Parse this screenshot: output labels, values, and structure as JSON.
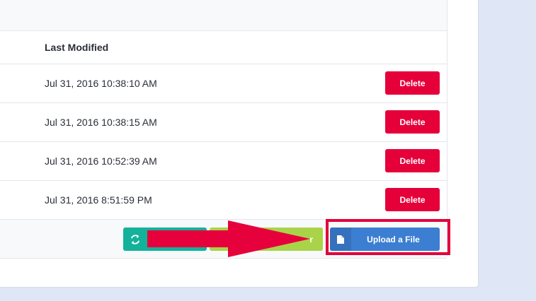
{
  "table": {
    "column_header": "Last Modified",
    "rows": [
      {
        "date": "Jul 31, 2016 10:38:10 AM",
        "action": "Delete"
      },
      {
        "date": "Jul 31, 2016 10:38:15 AM",
        "action": "Delete"
      },
      {
        "date": "Jul 31, 2016 10:52:39 AM",
        "action": "Delete"
      },
      {
        "date": "Jul 31, 2016 8:51:59 PM",
        "action": "Delete"
      }
    ]
  },
  "footer": {
    "refresh_icon": "refresh-icon",
    "folder_label_partial": "r",
    "upload_label": "Upload a File",
    "upload_icon": "file-icon"
  },
  "colors": {
    "delete": "#e5003a",
    "refresh": "#13b29a",
    "folder": "#a9d44a",
    "upload": "#3c7ed1",
    "highlight": "#e2003a"
  }
}
